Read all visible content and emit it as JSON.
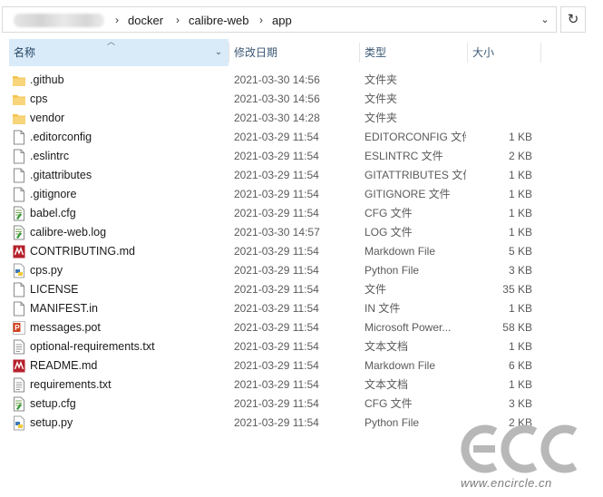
{
  "address": {
    "breadcrumbs": [
      "docker",
      "calibre-web",
      "app"
    ]
  },
  "columns": {
    "name": "名称",
    "date": "修改日期",
    "type": "类型",
    "size": "大小"
  },
  "files": [
    {
      "name": ".github",
      "date": "2021-03-30 14:56",
      "type": "文件夹",
      "size": "",
      "icon": "folder-icon"
    },
    {
      "name": "cps",
      "date": "2021-03-30 14:56",
      "type": "文件夹",
      "size": "",
      "icon": "folder-icon"
    },
    {
      "name": "vendor",
      "date": "2021-03-30 14:28",
      "type": "文件夹",
      "size": "",
      "icon": "folder-icon"
    },
    {
      "name": ".editorconfig",
      "date": "2021-03-29 11:54",
      "type": "EDITORCONFIG 文件",
      "size": "1 KB",
      "icon": "file-icon"
    },
    {
      "name": ".eslintrc",
      "date": "2021-03-29 11:54",
      "type": "ESLINTRC 文件",
      "size": "2 KB",
      "icon": "file-icon"
    },
    {
      "name": ".gitattributes",
      "date": "2021-03-29 11:54",
      "type": "GITATTRIBUTES 文件",
      "size": "1 KB",
      "icon": "file-icon"
    },
    {
      "name": ".gitignore",
      "date": "2021-03-29 11:54",
      "type": "GITIGNORE 文件",
      "size": "1 KB",
      "icon": "file-icon"
    },
    {
      "name": "babel.cfg",
      "date": "2021-03-29 11:54",
      "type": "CFG 文件",
      "size": "1 KB",
      "icon": "config-file-icon"
    },
    {
      "name": "calibre-web.log",
      "date": "2021-03-30 14:57",
      "type": "LOG 文件",
      "size": "1 KB",
      "icon": "config-file-icon"
    },
    {
      "name": "CONTRIBUTING.md",
      "date": "2021-03-29 11:54",
      "type": "Markdown File",
      "size": "5 KB",
      "icon": "markdown-file-icon"
    },
    {
      "name": "cps.py",
      "date": "2021-03-29 11:54",
      "type": "Python File",
      "size": "3 KB",
      "icon": "python-file-icon"
    },
    {
      "name": "LICENSE",
      "date": "2021-03-29 11:54",
      "type": "文件",
      "size": "35 KB",
      "icon": "file-icon"
    },
    {
      "name": "MANIFEST.in",
      "date": "2021-03-29 11:54",
      "type": "IN 文件",
      "size": "1 KB",
      "icon": "file-icon"
    },
    {
      "name": "messages.pot",
      "date": "2021-03-29 11:54",
      "type": "Microsoft Power...",
      "size": "58 KB",
      "icon": "powerpoint-file-icon"
    },
    {
      "name": "optional-requirements.txt",
      "date": "2021-03-29 11:54",
      "type": "文本文档",
      "size": "1 KB",
      "icon": "text-file-icon"
    },
    {
      "name": "README.md",
      "date": "2021-03-29 11:54",
      "type": "Markdown File",
      "size": "6 KB",
      "icon": "markdown-file-icon"
    },
    {
      "name": "requirements.txt",
      "date": "2021-03-29 11:54",
      "type": "文本文档",
      "size": "1 KB",
      "icon": "text-file-icon"
    },
    {
      "name": "setup.cfg",
      "date": "2021-03-29 11:54",
      "type": "CFG 文件",
      "size": "3 KB",
      "icon": "config-file-icon"
    },
    {
      "name": "setup.py",
      "date": "2021-03-29 11:54",
      "type": "Python File",
      "size": "2 KB",
      "icon": "python-file-icon"
    }
  ],
  "watermark": {
    "logo": "ECC",
    "url": "www.encircle.cn"
  },
  "colors": {
    "header_selected": "#d9ebf9",
    "folder": "#f4c24a",
    "markdown": "#b5202c",
    "powerpoint": "#d04423",
    "python": "#3f77b7"
  }
}
